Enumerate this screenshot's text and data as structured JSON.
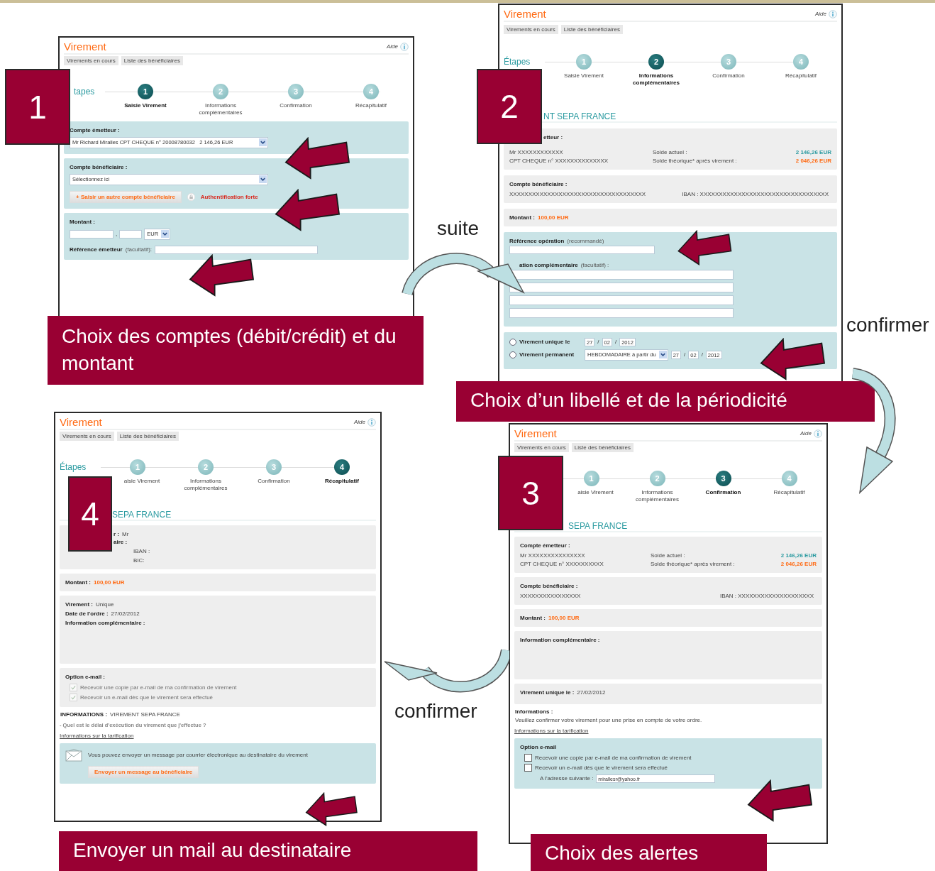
{
  "panels": [
    {
      "title": "Virement",
      "help": "Aide",
      "tabs": [
        "Virements en cours",
        "Liste des bénéficiaires"
      ],
      "steps_label": "tapes",
      "steps": [
        {
          "number": "1",
          "label": "Saisie Virement",
          "selected": true
        },
        {
          "number": "2",
          "label": "Informations complémentaires",
          "selected": false
        },
        {
          "number": "3",
          "label": "Confirmation",
          "selected": false
        },
        {
          "number": "4",
          "label": "Récapitulatif",
          "selected": false
        }
      ],
      "sections": [
        {
          "kind": "account_select",
          "label": "Compte émetteur :",
          "value": "Mr Richard Miralles CPT CHEQUE n° 20008780032   2 146,26 EUR"
        },
        {
          "kind": "beneficiary_select",
          "label": "Compte bénéficiaire :",
          "value": "Sélectionnez ici",
          "add_button": "+ Saisir un autre compte bénéficiaire",
          "auth_link": "Authentification forte"
        },
        {
          "kind": "amount_entry",
          "label": "Montant :",
          "separator": ",",
          "currency": "EUR",
          "reference_label": "Référence émetteur",
          "reference_hint": "(facultatif):"
        }
      ],
      "badge": "1",
      "caption": "Choix des comptes (débit/crédit) et du montant"
    },
    {
      "title": "Virement",
      "help": "Aide",
      "tabs": [
        "Virements en cours",
        "Liste des bénéficiaires"
      ],
      "steps_label": "Étapes",
      "steps": [
        {
          "number": "1",
          "label": "Saisie Virement",
          "selected": false
        },
        {
          "number": "2",
          "label": "Informations complémentaires",
          "selected": true
        },
        {
          "number": "3",
          "label": "Confirmation",
          "selected": false
        },
        {
          "number": "4",
          "label": "Récapitulatif",
          "selected": false
        }
      ],
      "sections": [
        {
          "kind": "heading",
          "text": "NT SEPA FRANCE"
        },
        {
          "kind": "emitter_summary",
          "label": "etteur :",
          "lines": [
            "Mr XXXXXXXXXXXX",
            "CPT CHEQUE n° XXXXXXXXXXXXXX"
          ],
          "balances": [
            {
              "label": "Solde actuel :",
              "value": "2 146,26 EUR",
              "kind": "current"
            },
            {
              "label": "Solde théorique* après virement :",
              "value": "2 046,26 EUR",
              "kind": "projected"
            }
          ]
        },
        {
          "kind": "beneficiary_summary",
          "label": "Compte bénéficiaire :",
          "account": "XXXXXXXXXXXXXXXXXXXXXXXXXXXXXXXXXXXX",
          "iban": "IBAN : XXXXXXXXXXXXXXXXXXXXXXXXXXXXXXXXXX"
        },
        {
          "kind": "amount_summary",
          "label": "Montant :",
          "value": "100,00 EUR"
        },
        {
          "kind": "reference_entry",
          "label": "Référence opération",
          "hint": "(recommandé)",
          "complement_label": "ation complémentaire",
          "complement_hint": "(facultatif) :"
        },
        {
          "kind": "schedule",
          "options": [
            {
              "label": "Virement unique le",
              "selected": false,
              "date": [
                "27",
                "/",
                "02",
                "/",
                "2012"
              ]
            },
            {
              "label": "Virement permanent",
              "selected": false,
              "frequency": "HEBDOMADAIRE à partir du",
              "date": [
                "27",
                "/",
                "02",
                "/",
                "2012"
              ]
            }
          ]
        }
      ],
      "badge": "2",
      "caption": "Choix d’un libellé et de la périodicité"
    },
    {
      "title": "Virement",
      "help": "Aide",
      "tabs": [
        "Virements en cours",
        "Liste des bénéficiaires"
      ],
      "steps_label": "Étapes",
      "steps": [
        {
          "number": "1",
          "label": "aisie Virement",
          "selected": false
        },
        {
          "number": "2",
          "label": "Informations complémentaires",
          "selected": false
        },
        {
          "number": "3",
          "label": "Confirmation",
          "selected": false
        },
        {
          "number": "4",
          "label": "Récapitulatif",
          "selected": true
        }
      ],
      "sections": [
        {
          "kind": "heading",
          "text": "SEPA FRANCE"
        },
        {
          "kind": "party_summary",
          "lines": [
            {
              "label": "r :",
              "value": "Mr"
            },
            {
              "label": "aire :"
            }
          ],
          "bank": [
            "IBAN :",
            "BIC:"
          ]
        },
        {
          "kind": "amount_summary",
          "label": "Montant :",
          "value": "100,00 EUR"
        },
        {
          "kind": "note_box",
          "rows": [
            {
              "label": "Virement :",
              "value": "Unique"
            },
            {
              "label": "Date de l'ordre :",
              "value": "27/02/2012"
            },
            {
              "label": "Information complémentaire :"
            }
          ]
        },
        {
          "kind": "email_options_summary",
          "label": "Option e-mail :",
          "options": [
            {
              "label": "Recevoir une copie par e-mail de ma confirmation de virement",
              "checked": true,
              "disabled": true
            },
            {
              "label": "Recevoir un e-mail dès que le virement sera effectué",
              "checked": true,
              "disabled": true
            }
          ]
        },
        {
          "kind": "info_inline",
          "label": "INFORMATIONS :",
          "text": "VIREMENT SEPA FRANCE"
        },
        {
          "kind": "faq_link",
          "text": "- Quel est le délai d'exécution du virement que j'effectue ?"
        },
        {
          "kind": "link",
          "text": "Informations sur la tarification"
        },
        {
          "kind": "message_box",
          "text": "Vous pouvez envoyer un message par courrier électronique au destinataire du virement",
          "button": "Envoyer un message au bénéficiaire"
        }
      ],
      "badge": "4",
      "caption": "Envoyer un mail au destinataire"
    },
    {
      "title": "Virement",
      "help": "Aide",
      "tabs": [
        "Virements en cours",
        "Liste des bénéficiaires"
      ],
      "steps": [
        {
          "number": "1",
          "label": "aisie Virement",
          "selected": false
        },
        {
          "number": "2",
          "label": "Informations complémentaires",
          "selected": false
        },
        {
          "number": "3",
          "label": "Confirmation",
          "selected": true
        },
        {
          "number": "4",
          "label": "Récapitulatif",
          "selected": false
        }
      ],
      "sections": [
        {
          "kind": "heading",
          "text": "SEPA FRANCE"
        },
        {
          "kind": "emitter_summary",
          "label": "Compte émetteur :",
          "lines": [
            "Mr XXXXXXXXXXXXXXX",
            "CPT CHEQUE n° XXXXXXXXXX"
          ],
          "balances": [
            {
              "label": "Solde actuel :",
              "value": "2 146,26 EUR",
              "kind": "current"
            },
            {
              "label": "Solde théorique* après virement :",
              "value": "2 046,26 EUR",
              "kind": "projected"
            }
          ]
        },
        {
          "kind": "beneficiary_summary",
          "label": "Compte bénéficiaire :",
          "account": "XXXXXXXXXXXXXXXX",
          "iban": "IBAN : XXXXXXXXXXXXXXXXXXXX"
        },
        {
          "kind": "amount_summary",
          "label": "Montant :",
          "value": "100,00 EUR"
        },
        {
          "kind": "note_box",
          "rows": [
            {
              "label": "Information complémentaire :"
            }
          ]
        },
        {
          "kind": "detail_rows",
          "rows": [
            {
              "label": "Virement unique le :",
              "value": "27/02/2012"
            }
          ]
        },
        {
          "kind": "info_text",
          "label": "Informations :",
          "text": "Veuillez confirmer votre virement pour une prise en compte de votre ordre."
        },
        {
          "kind": "link",
          "text": "Informations sur la tarification"
        },
        {
          "kind": "email_options_edit",
          "label": "Option e-mail",
          "options": [
            {
              "label": "Recevoir une copie par e-mail de ma confirmation de virement",
              "checked": false,
              "disabled": false
            },
            {
              "label": "Recevoir un e-mail dès que le virement sera effectué",
              "checked": false,
              "disabled": false
            }
          ],
          "address_label": "A l'adresse suivante :",
          "address": "mirallesr@yahoo.fr"
        }
      ],
      "badge": "3",
      "caption": "Choix des alertes"
    }
  ],
  "connectors": [
    {
      "label": "suite"
    },
    {
      "label": "confirmer"
    },
    {
      "label": "confirmer"
    }
  ]
}
